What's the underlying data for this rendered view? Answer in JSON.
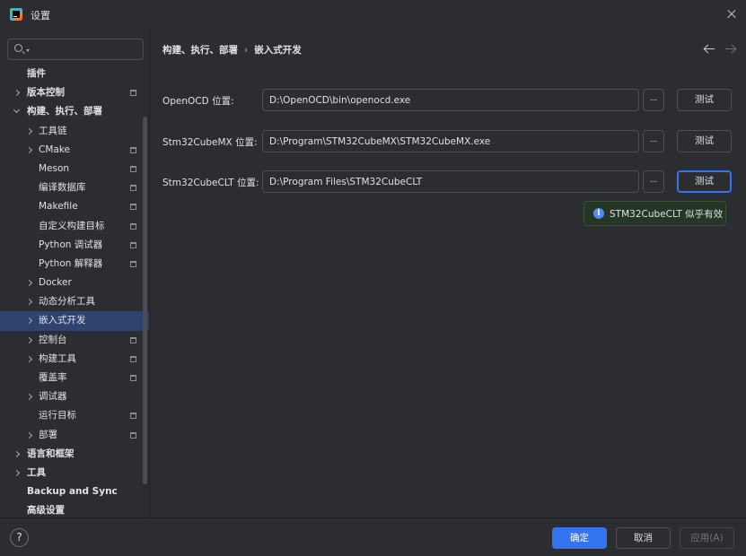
{
  "window": {
    "title": "设置"
  },
  "search": {
    "placeholder": "",
    "value": ""
  },
  "sidebar": {
    "items": [
      {
        "label": "插件",
        "bold": true,
        "indent": 0,
        "chevron": "none",
        "doc": false
      },
      {
        "label": "版本控制",
        "bold": true,
        "indent": 0,
        "chevron": "right",
        "doc": true
      },
      {
        "label": "构建、执行、部署",
        "bold": true,
        "indent": 0,
        "chevron": "down",
        "doc": false
      },
      {
        "label": "工具链",
        "bold": false,
        "indent": 1,
        "chevron": "right",
        "doc": false
      },
      {
        "label": "CMake",
        "bold": false,
        "indent": 1,
        "chevron": "right",
        "doc": true
      },
      {
        "label": "Meson",
        "bold": false,
        "indent": 1,
        "chevron": "none",
        "doc": true
      },
      {
        "label": "编译数据库",
        "bold": false,
        "indent": 1,
        "chevron": "none",
        "doc": true
      },
      {
        "label": "Makefile",
        "bold": false,
        "indent": 1,
        "chevron": "none",
        "doc": true
      },
      {
        "label": "自定义构建目标",
        "bold": false,
        "indent": 1,
        "chevron": "none",
        "doc": true
      },
      {
        "label": "Python 调试器",
        "bold": false,
        "indent": 1,
        "chevron": "none",
        "doc": true
      },
      {
        "label": "Python 解释器",
        "bold": false,
        "indent": 1,
        "chevron": "none",
        "doc": true
      },
      {
        "label": "Docker",
        "bold": false,
        "indent": 1,
        "chevron": "right",
        "doc": false
      },
      {
        "label": "动态分析工具",
        "bold": false,
        "indent": 1,
        "chevron": "right",
        "doc": false
      },
      {
        "label": "嵌入式开发",
        "bold": false,
        "indent": 1,
        "chevron": "right",
        "doc": false,
        "selected": true
      },
      {
        "label": "控制台",
        "bold": false,
        "indent": 1,
        "chevron": "right",
        "doc": true
      },
      {
        "label": "构建工具",
        "bold": false,
        "indent": 1,
        "chevron": "right",
        "doc": true
      },
      {
        "label": "覆盖率",
        "bold": false,
        "indent": 1,
        "chevron": "none",
        "doc": true
      },
      {
        "label": "调试器",
        "bold": false,
        "indent": 1,
        "chevron": "right",
        "doc": false
      },
      {
        "label": "运行目标",
        "bold": false,
        "indent": 1,
        "chevron": "none",
        "doc": true
      },
      {
        "label": "部署",
        "bold": false,
        "indent": 1,
        "chevron": "right",
        "doc": true
      },
      {
        "label": "语言和框架",
        "bold": true,
        "indent": 0,
        "chevron": "right",
        "doc": false
      },
      {
        "label": "工具",
        "bold": true,
        "indent": 0,
        "chevron": "right",
        "doc": false
      },
      {
        "label": "Backup and Sync",
        "bold": true,
        "indent": 0,
        "chevron": "none",
        "doc": false
      },
      {
        "label": "高级设置",
        "bold": true,
        "indent": 0,
        "chevron": "none",
        "doc": false
      }
    ]
  },
  "breadcrumb": {
    "parent": "构建、执行、部署",
    "separator": "›",
    "current": "嵌入式开发"
  },
  "settings": {
    "rows": [
      {
        "label": "OpenOCD 位置:",
        "value": "D:\\OpenOCD\\bin\\openocd.exe",
        "browse": "...",
        "test": "测试",
        "focused": false
      },
      {
        "label": "Stm32CubeMX 位置:",
        "value": "D:\\Program\\STM32CubeMX\\STM32CubeMX.exe",
        "browse": "...",
        "test": "测试",
        "focused": false
      },
      {
        "label": "Stm32CubeCLT 位置:",
        "value": "D:\\Program Files\\STM32CubeCLT",
        "browse": "...",
        "test": "测试",
        "focused": true
      }
    ],
    "tooltip": {
      "icon": "info-icon",
      "text": "STM32CubeCLT 似乎有效"
    }
  },
  "footer": {
    "help": "?",
    "ok": "确定",
    "cancel": "取消",
    "apply": "应用(A)"
  },
  "colors": {
    "accent": "#3574f0",
    "selection": "#2e436e",
    "background": "#2b2d30",
    "tooltip_bg": "#253627"
  }
}
